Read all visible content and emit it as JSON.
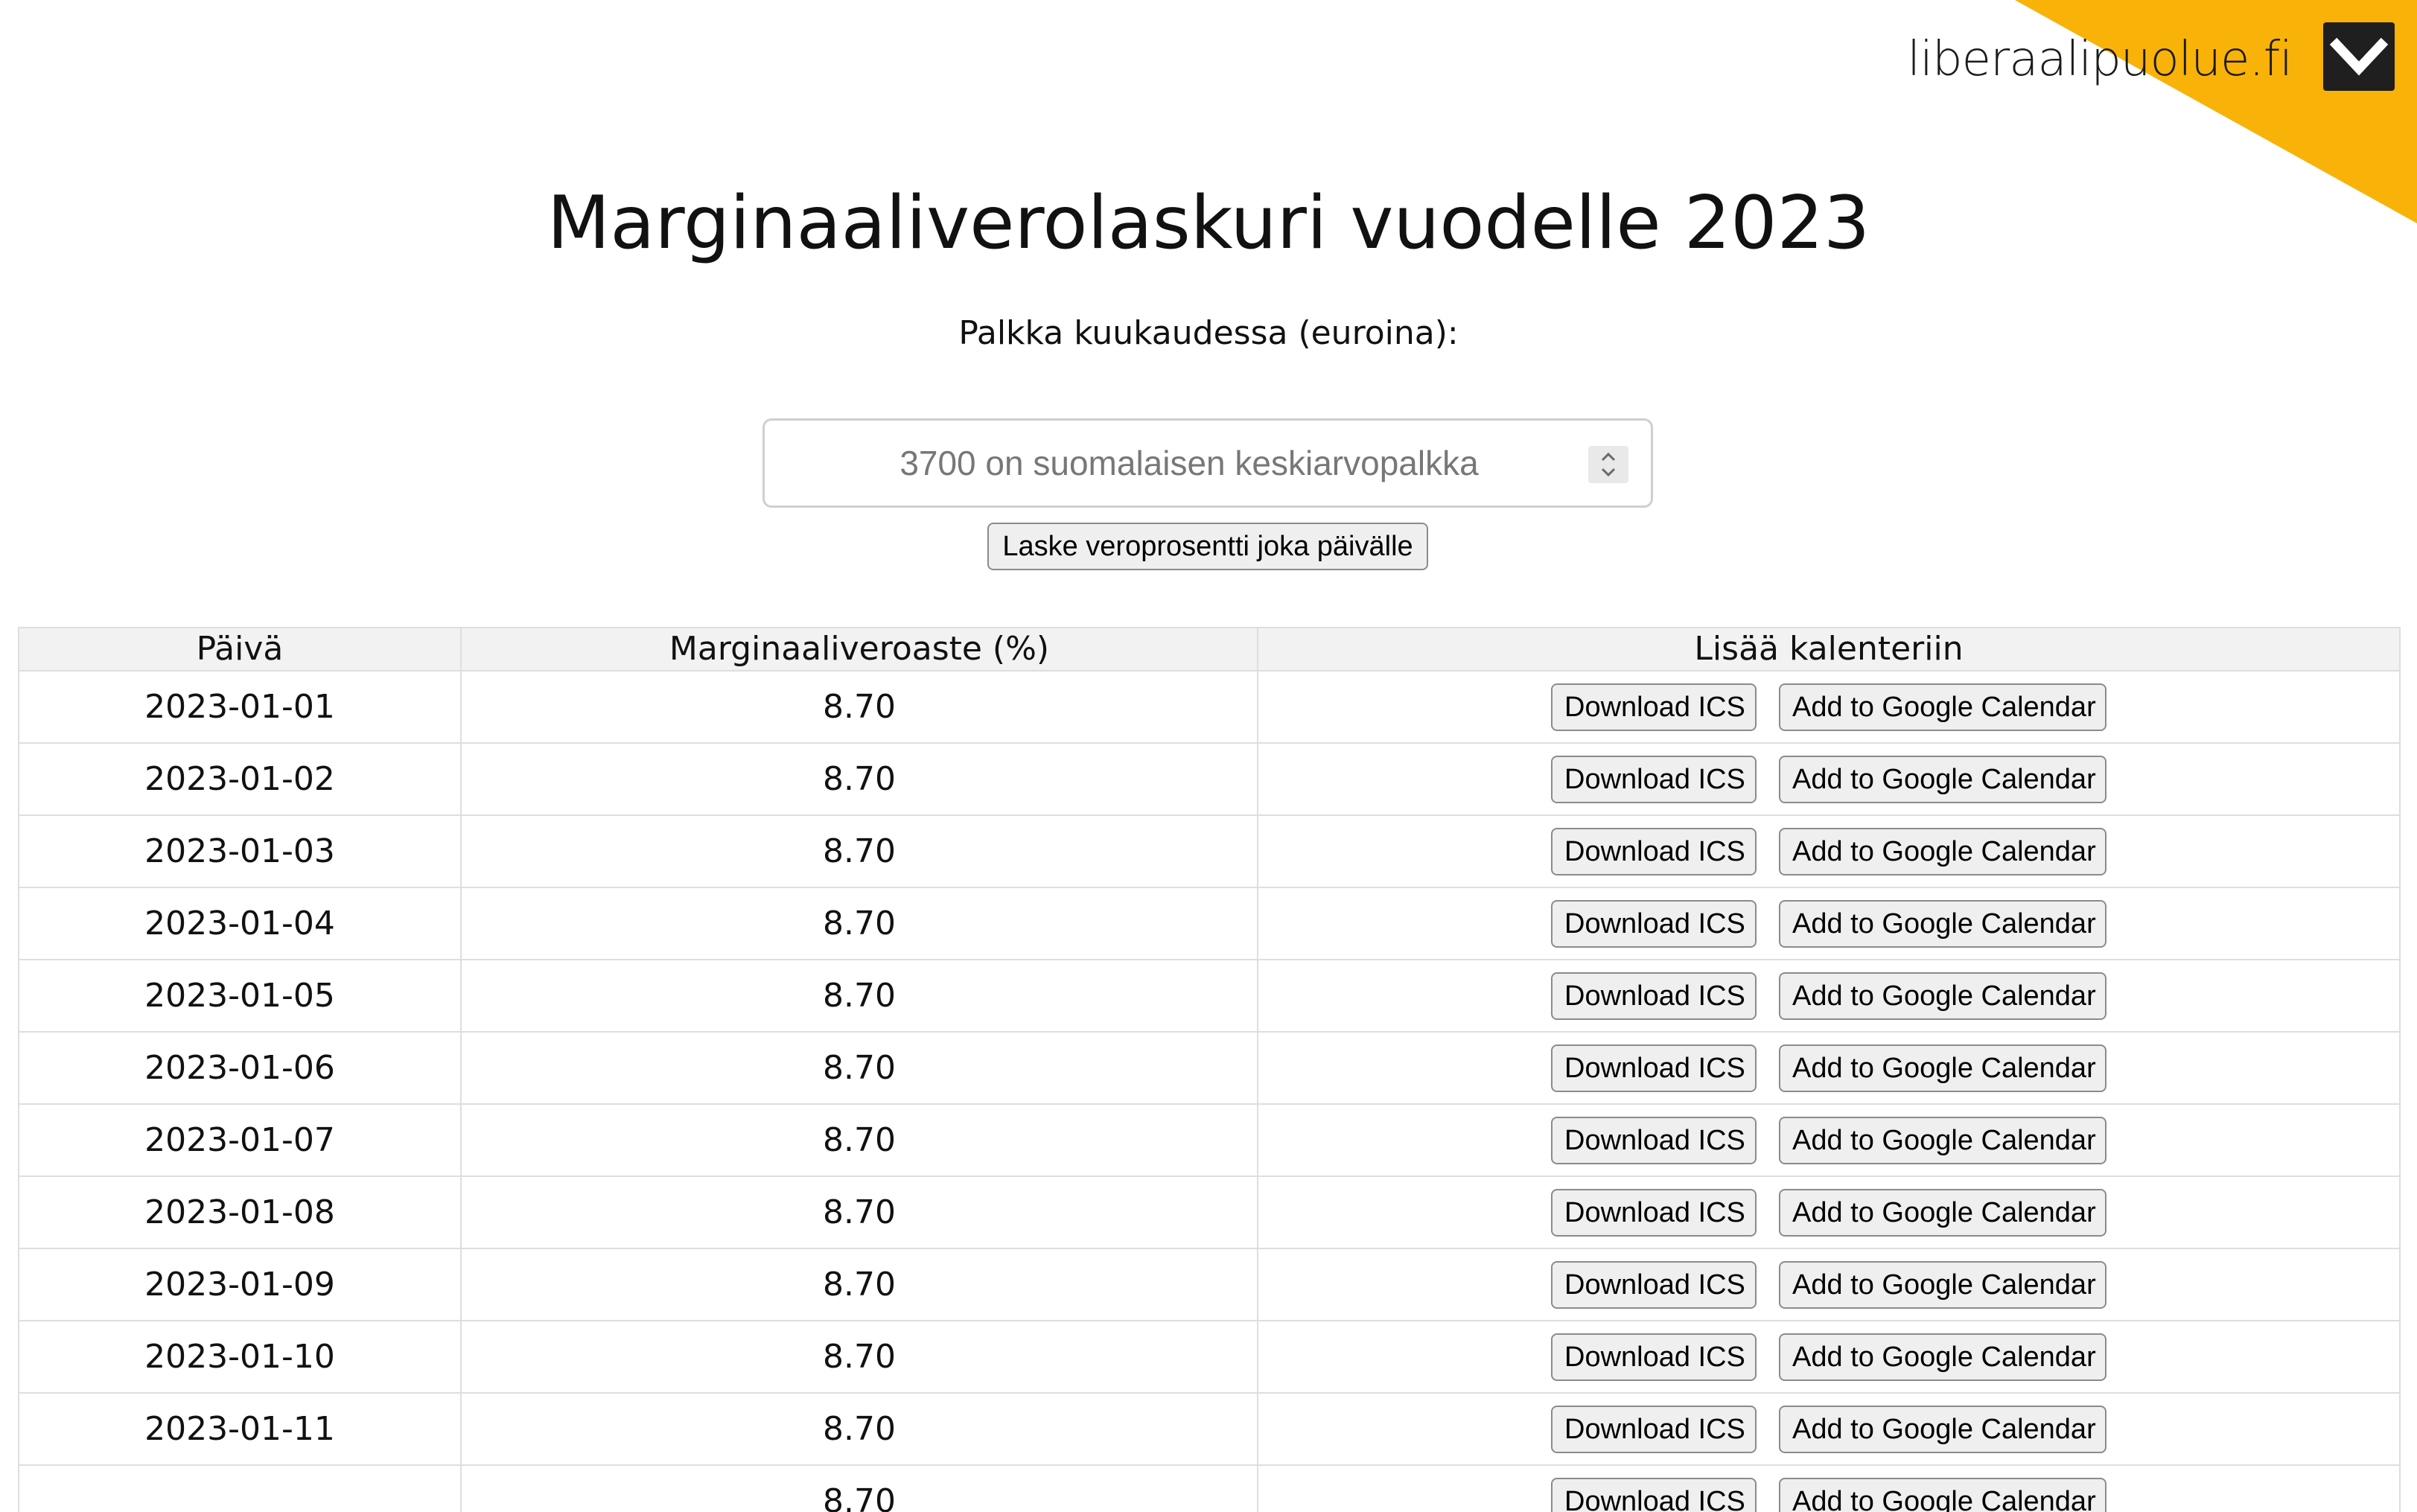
{
  "brand": {
    "site_name": "liberaalipuolue.fi",
    "logo_icon": "chevron-down-logo",
    "accent_color": "#f9b208"
  },
  "title": "Marginaaliverolaskuri vuodelle 2023",
  "salary": {
    "label": "Palkka kuukaudessa (euroina):",
    "placeholder": "3700 on suomalaisen keskiarvopalkka",
    "value": ""
  },
  "calculate_button": "Laske veroprosentti joka päivälle",
  "table": {
    "headers": [
      "Päivä",
      "Marginaaliveroaste (%)",
      "Lisää kalenteriin"
    ],
    "download_ics_label": "Download ICS",
    "google_calendar_label": "Add to Google Calendar",
    "rows": [
      {
        "date": "2023-01-01",
        "rate": "8.70"
      },
      {
        "date": "2023-01-02",
        "rate": "8.70"
      },
      {
        "date": "2023-01-03",
        "rate": "8.70"
      },
      {
        "date": "2023-01-04",
        "rate": "8.70"
      },
      {
        "date": "2023-01-05",
        "rate": "8.70"
      },
      {
        "date": "2023-01-06",
        "rate": "8.70"
      },
      {
        "date": "2023-01-07",
        "rate": "8.70"
      },
      {
        "date": "2023-01-08",
        "rate": "8.70"
      },
      {
        "date": "2023-01-09",
        "rate": "8.70"
      },
      {
        "date": "2023-01-10",
        "rate": "8.70"
      },
      {
        "date": "2023-01-11",
        "rate": "8.70"
      },
      {
        "date": "",
        "rate": "8.70"
      }
    ]
  }
}
